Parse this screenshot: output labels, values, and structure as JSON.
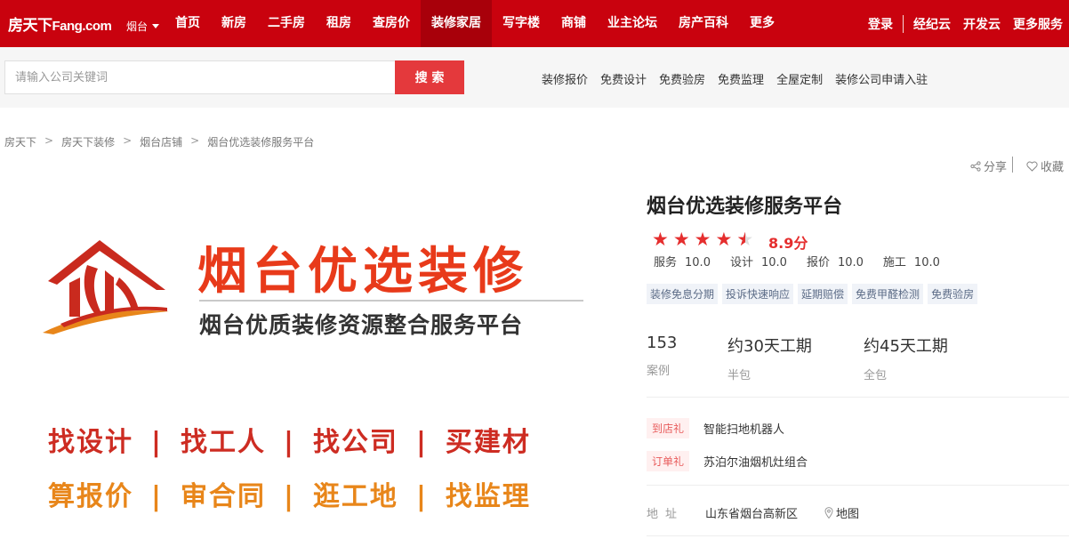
{
  "nav": {
    "logo_cn": "房天下",
    "logo_en": "Fang.com",
    "city": "烟台",
    "items": [
      "首页",
      "新房",
      "二手房",
      "租房",
      "查房价",
      "装修家居",
      "写字楼",
      "商铺",
      "业主论坛",
      "房产百科",
      "更多"
    ],
    "active_index": 5,
    "login": "登录",
    "right": [
      "经纪云",
      "开发云",
      "更多服务"
    ]
  },
  "search": {
    "placeholder": "请输入公司关键词",
    "button": "搜 索",
    "links": [
      "装修报价",
      "免费设计",
      "免费验房",
      "免费监理",
      "全屋定制",
      "装修公司申请入驻"
    ]
  },
  "breadcrumb": [
    "房天下",
    "房天下装修",
    "烟台店铺",
    "烟台优选装修服务平台"
  ],
  "actions": {
    "share": "分享",
    "favorite": "收藏"
  },
  "banner": {
    "title": "烟台优选装修",
    "subtitle": "烟台优质装修资源整合服务平台",
    "row1": [
      "找设计",
      "找工人",
      "找公司",
      "买建材"
    ],
    "row2": [
      "算报价",
      "审合同",
      "逛工地",
      "找监理"
    ],
    "separator": "|"
  },
  "shop": {
    "name": "烟台优选装修服务平台",
    "rating": 4.5,
    "score": "8.9分",
    "subscores": [
      {
        "label": "服务",
        "value": "10.0"
      },
      {
        "label": "设计",
        "value": "10.0"
      },
      {
        "label": "报价",
        "value": "10.0"
      },
      {
        "label": "施工",
        "value": "10.0"
      }
    ],
    "tags": [
      "装修免息分期",
      "投诉快速响应",
      "延期赔偿",
      "免费甲醛检测",
      "免费验房"
    ],
    "stats": [
      {
        "value": "153",
        "label": "案例"
      },
      {
        "value": "约30天工期",
        "label": "半包"
      },
      {
        "value": "约45天工期",
        "label": "全包"
      }
    ],
    "gifts": [
      {
        "tag": "到店礼",
        "text": "智能扫地机器人"
      },
      {
        "tag": "订单礼",
        "text": "苏泊尔油烟机灶组合"
      }
    ],
    "address_label": "地址",
    "address": "山东省烟台高新区",
    "map_label": "地图"
  },
  "colors": {
    "brand_red": "#c9020e",
    "search_red": "#e4393c",
    "banner_orange": "#e8861a",
    "banner_red": "#cd2c22"
  }
}
